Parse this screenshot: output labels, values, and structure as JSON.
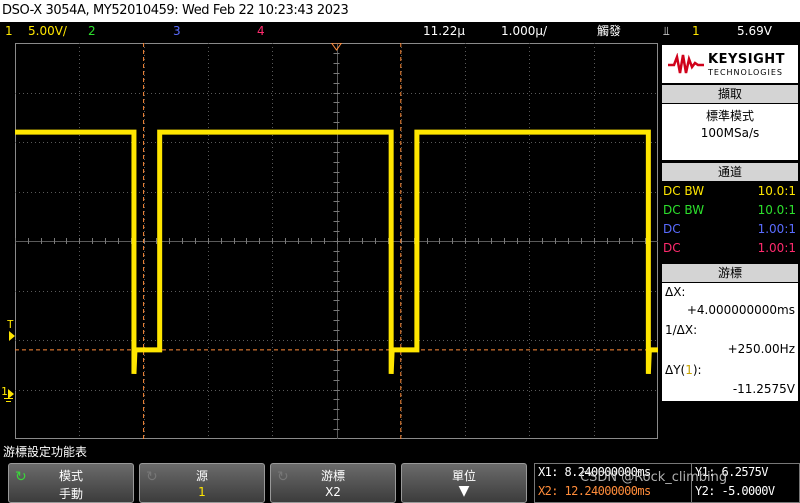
{
  "titlebar": {
    "text": "DSO-X 3054A, MY52010459: Wed Feb 22 10:23:43 2023"
  },
  "status": {
    "ch1_num": "1",
    "ch1_scale": "5.00V/",
    "ch2_num": "2",
    "ch3_num": "3",
    "ch4_num": "4",
    "delay": "11.22µ",
    "timebase": "1.000µ/",
    "mode": "觸發",
    "trig_symbol": "⫫",
    "trig_ch": "1",
    "trig_level": "5.69V"
  },
  "markers": {
    "trigger_level": "T",
    "ground_ch1": "1"
  },
  "panel": {
    "brand": "KEYSIGHT",
    "brand_sub": "TECHNOLOGIES",
    "acq_header": "擷取",
    "acq_mode": "標準模式",
    "acq_rate": "100MSa/s",
    "chan_header": "通道",
    "channels": [
      {
        "coupling": "DC BW",
        "probe": "10.0:1",
        "color": "#ffe600"
      },
      {
        "coupling": "DC BW",
        "probe": "10.0:1",
        "color": "#2de02d"
      },
      {
        "coupling": "DC",
        "probe": "1.00:1",
        "color": "#5a6cff"
      },
      {
        "coupling": "DC",
        "probe": "1.00:1",
        "color": "#ff2a6d"
      }
    ],
    "cursor_header": "游標",
    "dx_label": "ΔX:",
    "dx_value": "+4.000000000ms",
    "inv_dx_label": "1/ΔX:",
    "inv_dx_value": "+250.00Hz",
    "dy_label_pre": "ΔY(",
    "dy_label_ch": "1",
    "dy_label_post": "):",
    "dy_value": "-11.2575V"
  },
  "bottom": {
    "menu_title": "游標設定功能表",
    "softkeys": [
      {
        "line1": "模式",
        "line2": "手動"
      },
      {
        "line1": "源",
        "line2": "1"
      },
      {
        "line1": "游標",
        "line2": "X2"
      },
      {
        "line1": "單位",
        "line2": "▼"
      }
    ],
    "cursor_readout": {
      "x1": "X1: 8.240000000ms",
      "x2": "X2: 12.24000000ms",
      "y1": "Y1: 6.2575V",
      "y2": "Y2: -5.0000V"
    },
    "watermark": "CSDN @Rock_climbing"
  },
  "colors": {
    "ch1": "#ffe600",
    "ch2": "#2de02d",
    "ch3": "#5a6cff",
    "ch4": "#ff2a6d",
    "cursor": "#ff8c3a",
    "x2_readout": "#ff8c3a"
  },
  "waveform": {
    "high_level_div": 2.2,
    "low_level_div": -2.2,
    "pulse_low_start_div": 2.25,
    "pulse_low_end_div": 2.65,
    "pulse_period_div": 4.0
  }
}
